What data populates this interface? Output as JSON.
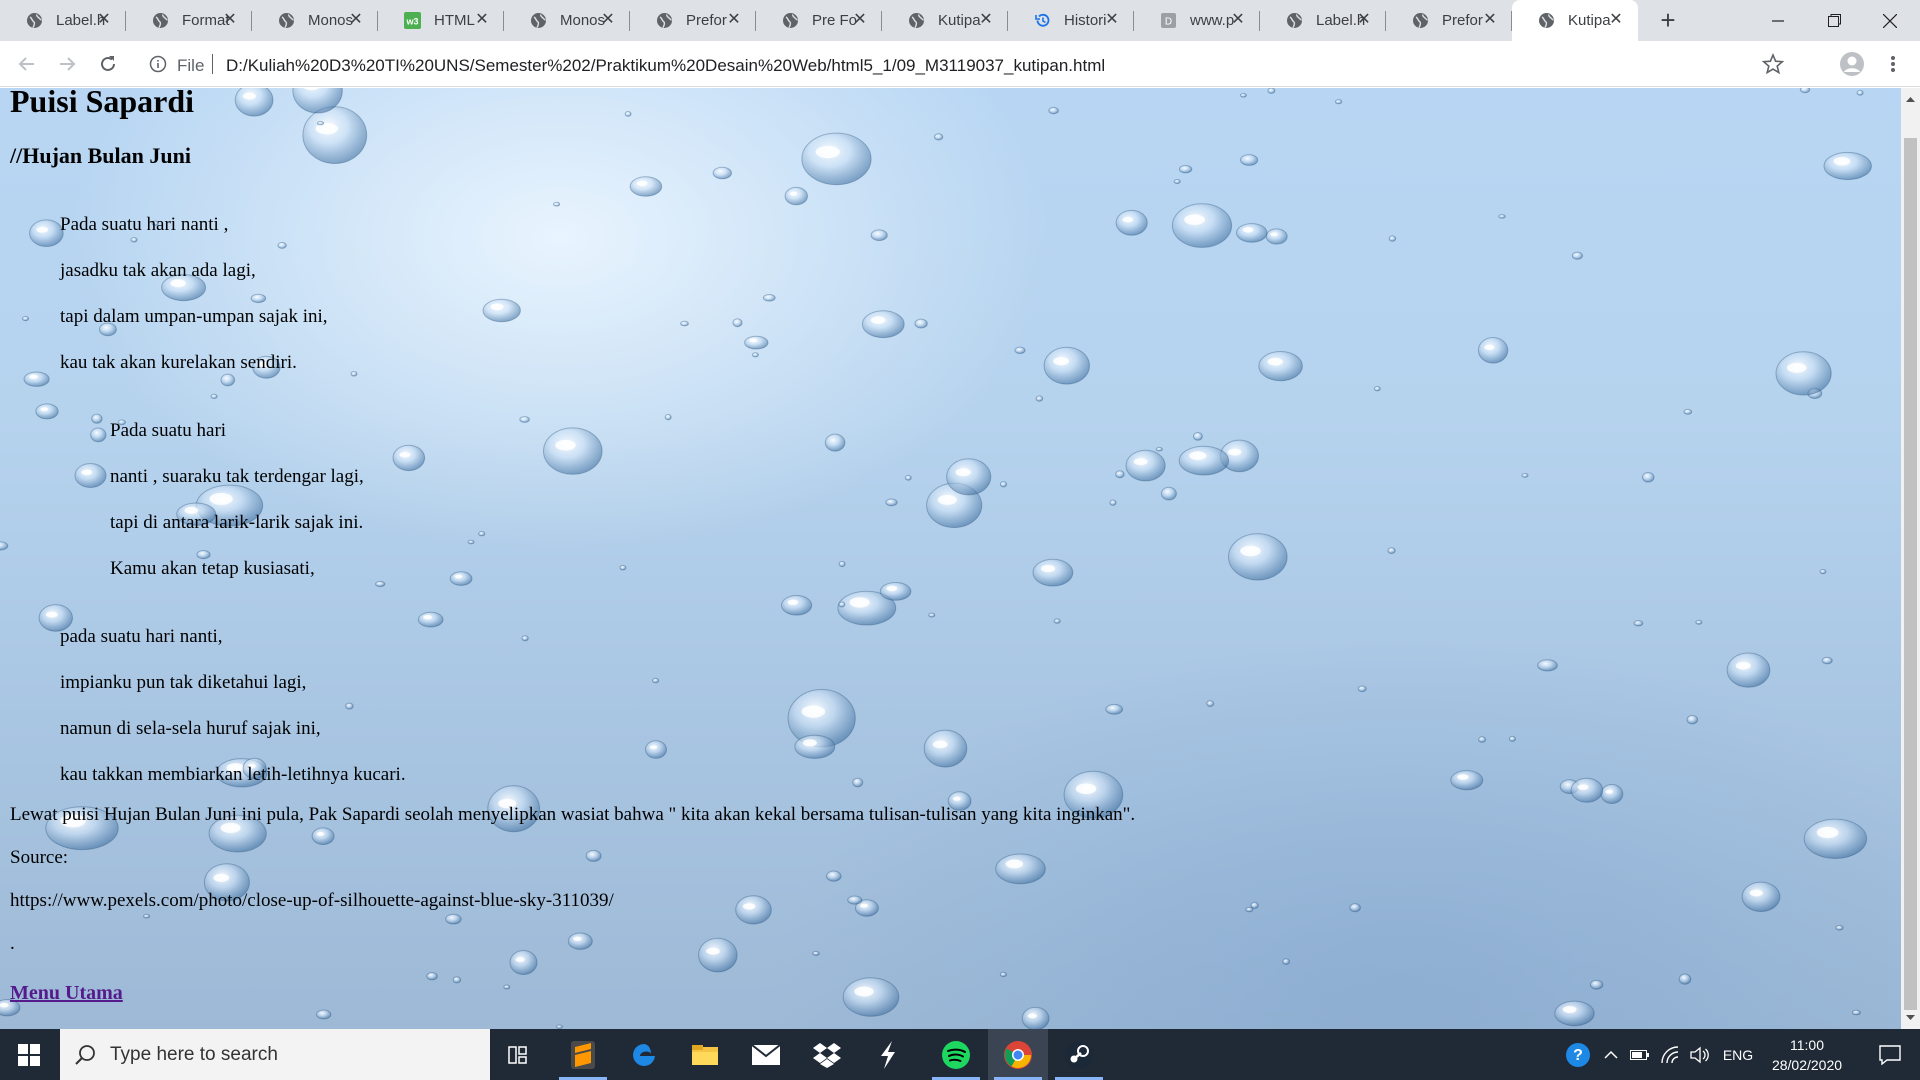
{
  "browser": {
    "tabs": [
      {
        "title": "Label.h",
        "icon": "globe-icon"
      },
      {
        "title": "Format",
        "icon": "globe-icon"
      },
      {
        "title": "Monos",
        "icon": "globe-icon"
      },
      {
        "title": "HTML",
        "icon": "w3-icon"
      },
      {
        "title": "Monos",
        "icon": "globe-icon"
      },
      {
        "title": "Prefor",
        "icon": "globe-icon"
      },
      {
        "title": "Pre Fo",
        "icon": "globe-icon"
      },
      {
        "title": "Kutipa",
        "icon": "globe-icon"
      },
      {
        "title": "Histori",
        "icon": "history-icon"
      },
      {
        "title": "www.p",
        "icon": "document-icon"
      },
      {
        "title": "Label.h",
        "icon": "globe-icon"
      },
      {
        "title": "Prefor",
        "icon": "globe-icon"
      },
      {
        "title": "Kutipa",
        "icon": "globe-icon",
        "active": true
      }
    ],
    "address": {
      "scheme_label": "File",
      "url": "D:/Kuliah%20D3%20TI%20UNS/Semester%202/Praktikum%20Desain%20Web/html5_1/09_M3119037_kutipan.html"
    }
  },
  "page": {
    "title": "Puisi Sapardi",
    "subtitle": "//Hujan Bulan Juni",
    "stanza1": [
      "Pada suatu hari nanti ,",
      "jasadku tak akan ada lagi,",
      "tapi dalam umpan-umpan sajak ini,",
      "kau tak akan kurelakan sendiri."
    ],
    "stanza2": [
      "Pada suatu hari",
      "nanti , suaraku tak terdengar lagi,",
      "tapi di antara larik-larik sajak ini.",
      "Kamu akan tetap kusiasati,"
    ],
    "stanza3": [
      "pada suatu hari nanti,",
      "impianku pun tak diketahui lagi,",
      "namun di sela-sela huruf sajak ini,",
      "kau takkan membiarkan letih-letihnya kucari."
    ],
    "closing": "Lewat puisi Hujan Bulan Juni ini pula, Pak Sapardi seolah menyelipkan wasiat bahwa \" kita akan kekal bersama tulisan-tulisan yang kita inginkan\".",
    "source_label": "Source:",
    "source_url": "https://www.pexels.com/photo/close-up-of-silhouette-against-blue-sky-311039/",
    "dot": ".",
    "menu_link": "Menu Utama"
  },
  "taskbar": {
    "search_placeholder": "Type here to search",
    "language": "ENG",
    "time": "11:00",
    "date": "28/02/2020"
  },
  "colors": {
    "tabstrip": "#dee1e6",
    "link_visited": "#551a8b",
    "taskbar": "#202a36"
  }
}
